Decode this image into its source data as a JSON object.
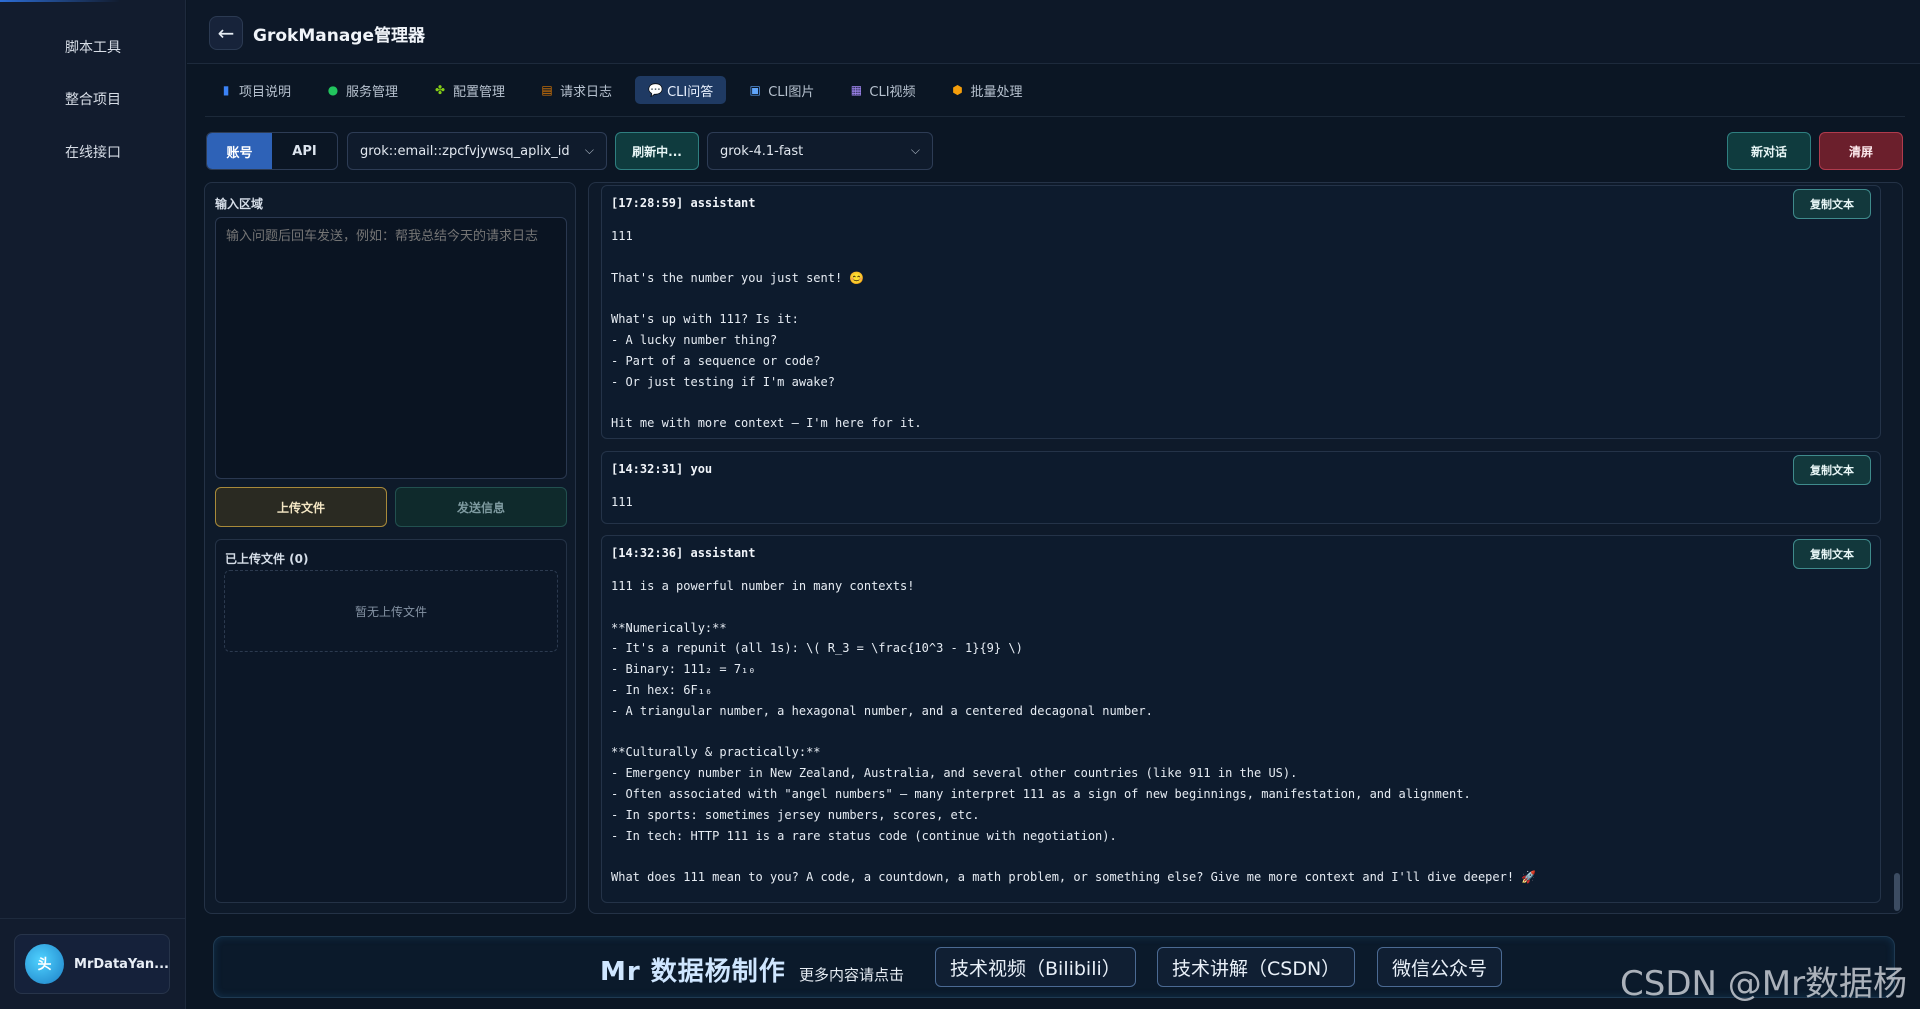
{
  "sidebar": {
    "items": [
      {
        "label": "脚本工具"
      },
      {
        "label": "整合项目"
      },
      {
        "label": "在线接口"
      }
    ],
    "user": {
      "avatar_text": "头",
      "name": "MrDataYan..."
    }
  },
  "header": {
    "back_icon": "←",
    "title": "GrokManage管理器"
  },
  "tabs": [
    {
      "label": "项目说明",
      "icon": "book-icon",
      "color": "#3b82f6"
    },
    {
      "label": "服务管理",
      "icon": "green-dot-icon",
      "color": "#22c55e"
    },
    {
      "label": "配置管理",
      "icon": "puzzle-icon",
      "color": "#84cc16"
    },
    {
      "label": "请求日志",
      "icon": "log-icon",
      "color": "#d97706"
    },
    {
      "label": "CLI问答",
      "icon": "chat-icon",
      "color": "#ffffff",
      "active": true
    },
    {
      "label": "CLI图片",
      "icon": "image-icon",
      "color": "#60a5fa"
    },
    {
      "label": "CLI视频",
      "icon": "video-icon",
      "color": "#a78bfa"
    },
    {
      "label": "批量处理",
      "icon": "box-icon",
      "color": "#f59e0b"
    }
  ],
  "toolbar": {
    "mode_options": [
      "账号",
      "API"
    ],
    "selected_mode": "账号",
    "account_select": "grok::email::zpcfvjywsq_aplix_id",
    "refresh_label": "刷新中...",
    "model_select": "grok-4.1-fast",
    "new_chat_label": "新对话",
    "clear_label": "清屏"
  },
  "input": {
    "section_label": "输入区域",
    "placeholder": "输入问题后回车发送，例如：帮我总结今天的请求日志",
    "upload_label": "上传文件",
    "send_label": "发送信息",
    "files_label": "已上传文件 (0)",
    "files_empty": "暂无上传文件"
  },
  "messages": [
    {
      "meta": "[17:28:59] assistant",
      "copy_label": "复制文本",
      "text": "111\n\nThat's the number you just sent! 😊\n\nWhat's up with 111? Is it:\n- A lucky number thing?\n- Part of a sequence or code?\n- Or just testing if I'm awake?\n\nHit me with more context — I'm here for it."
    },
    {
      "meta": "[14:32:31] you",
      "copy_label": "复制文本",
      "text": "111"
    },
    {
      "meta": "[14:32:36] assistant",
      "copy_label": "复制文本",
      "text": "111 is a powerful number in many contexts!\n\n**Numerically:**\n- It's a repunit (all 1s): \\( R_3 = \\frac{10^3 - 1}{9} \\)\n- Binary: 111₂ = 7₁₀\n- In hex: 6F₁₆\n- A triangular number, a hexagonal number, and a centered decagonal number.\n\n**Culturally & practically:**\n- Emergency number in New Zealand, Australia, and several other countries (like 911 in the US).\n- Often associated with \"angel numbers\" — many interpret 111 as a sign of new beginnings, manifestation, and alignment.\n- In sports: sometimes jersey numbers, scores, etc.\n- In tech: HTTP 111 is a rare status code (continue with negotiation).\n\nWhat does 111 mean to you? A code, a countdown, a math problem, or something else? Give me more context and I'll dive deeper! 🚀"
    }
  ],
  "banner": {
    "brand": "Mr 数据杨制作",
    "sub": "更多内容请点击",
    "links": [
      "技术视频（Bilibili）",
      "技术讲解（CSDN）",
      "微信公众号"
    ]
  },
  "watermark": "CSDN @Mr数据杨"
}
